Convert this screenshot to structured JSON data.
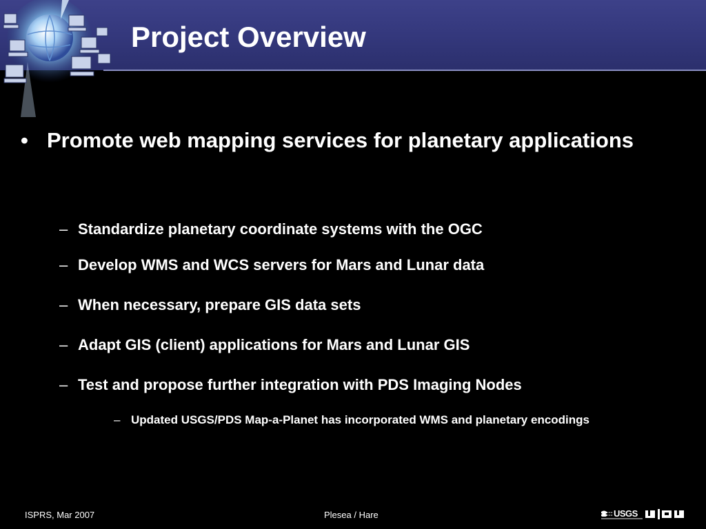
{
  "slide": {
    "title": "Project Overview",
    "bullets": [
      {
        "marker": "•",
        "text": "Promote web mapping services for planetary applications",
        "subitems": [
          {
            "marker": "–",
            "text": "Standardize planetary coordinate systems with the OGC"
          },
          {
            "marker": "–",
            "text": "Develop WMS and WCS servers for Mars and Lunar data"
          },
          {
            "marker": "–",
            "text": "When necessary, prepare GIS data sets"
          },
          {
            "marker": "–",
            "text": "Adapt GIS (client) applications for Mars and Lunar GIS"
          },
          {
            "marker": "–",
            "text": "Test and propose further integration with PDS Imaging Nodes",
            "subitems": [
              {
                "marker": "–",
                "text": "Updated USGS/PDS Map-a-Planet  has incorporated WMS and planetary encodings"
              }
            ]
          }
        ]
      }
    ]
  },
  "footer": {
    "left": "ISPRS, Mar 2007",
    "center": "Plesea / Hare",
    "logos": {
      "usgs": "USGS"
    }
  },
  "colors": {
    "header_band": "#363a80",
    "background": "#000000",
    "text": "#ffffff"
  },
  "icons": {
    "header_graphic": "globe-network-icon",
    "footer_logo_1": "usgs-logo",
    "footer_logo_2": "jpl-logo"
  }
}
